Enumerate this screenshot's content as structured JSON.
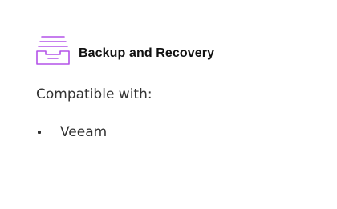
{
  "card": {
    "title": "Backup and Recovery",
    "icon": "tray-stack-icon",
    "accent_color": "#c061f0",
    "compatible_label": "Compatible with:",
    "compatible_items": [
      {
        "label": "Veeam"
      }
    ]
  }
}
